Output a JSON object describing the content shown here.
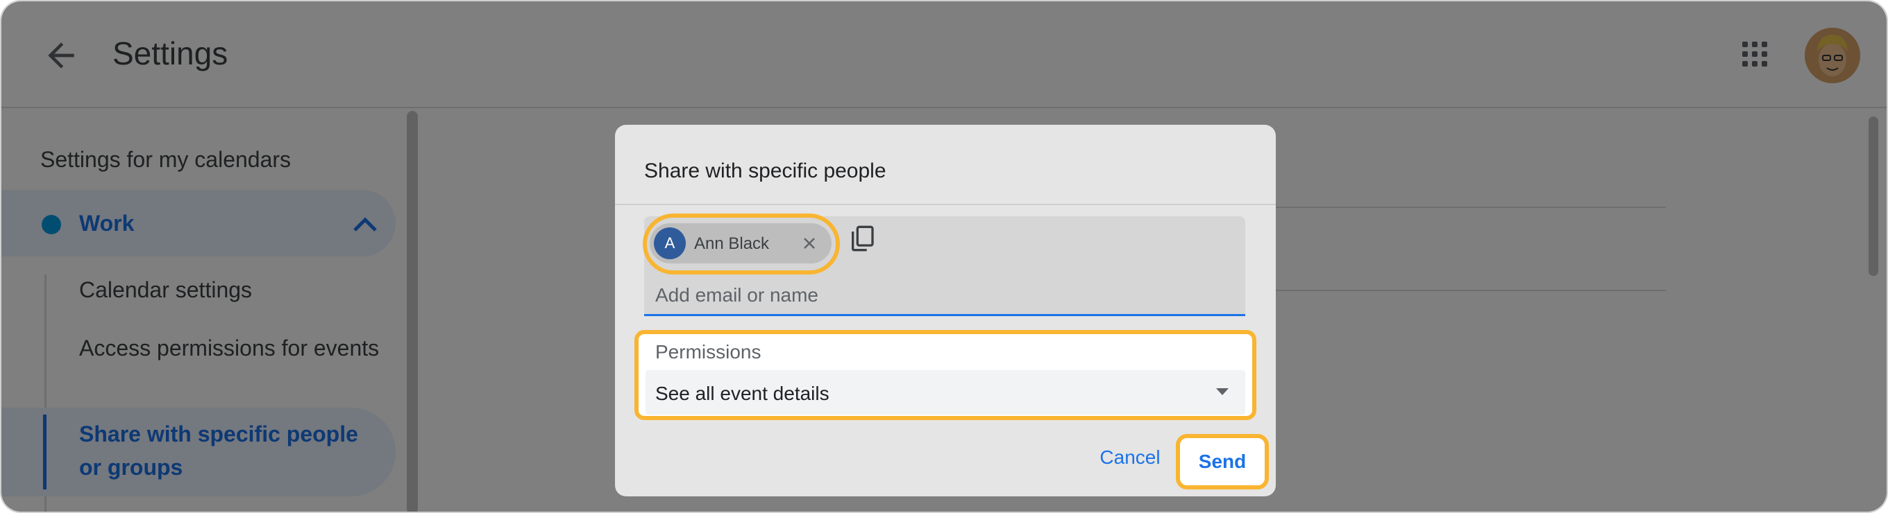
{
  "app": {
    "title": "Settings"
  },
  "icons": {
    "back": "back-arrow-icon",
    "apps": "apps-grid-icon",
    "calendar_dot": "calendar-color-dot",
    "collapse": "chevron-up-icon",
    "remove_chip": "close-icon",
    "copy": "copy-icon",
    "dropdown": "dropdown-arrow-icon"
  },
  "sidebar": {
    "heading": "Settings for my calendars",
    "calendar": {
      "label": "Work",
      "color": "#039be5"
    },
    "items": [
      {
        "label": "Calendar settings"
      },
      {
        "label": "Access permissions for events"
      },
      {
        "label": "Share with specific people or groups",
        "active": true
      }
    ]
  },
  "dialog": {
    "title": "Share with specific people",
    "chip": {
      "initial": "A",
      "name": "Ann Black"
    },
    "email_placeholder": "Add email or name",
    "permissions": {
      "label": "Permissions",
      "selected": "See all event details"
    },
    "cancel_label": "Cancel",
    "send_label": "Send"
  },
  "colors": {
    "accent": "#1a73e8",
    "highlight": "#f9b531",
    "chip_avatar": "#2f5b9a"
  }
}
